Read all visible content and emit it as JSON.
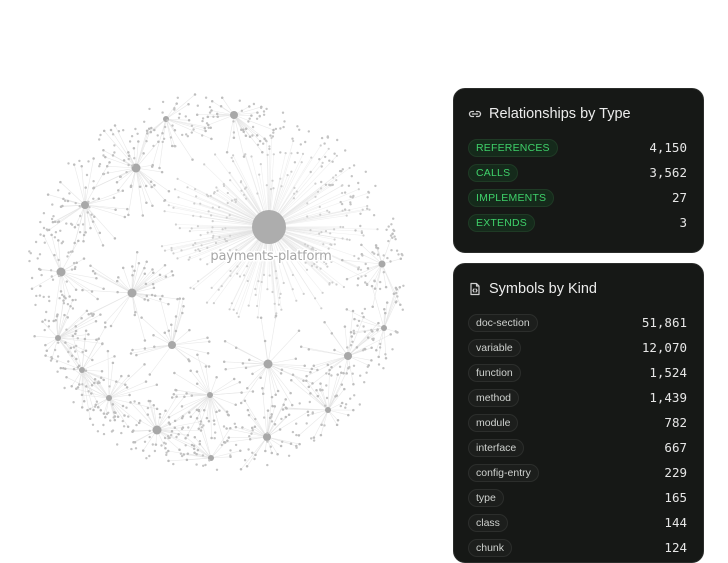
{
  "graph": {
    "center_label": "payments-platform"
  },
  "relationships_panel": {
    "title": "Relationships by Type",
    "icon": "link-icon",
    "items": [
      {
        "label": "REFERENCES",
        "count": "4,150"
      },
      {
        "label": "CALLS",
        "count": "3,562"
      },
      {
        "label": "IMPLEMENTS",
        "count": "27"
      },
      {
        "label": "EXTENDS",
        "count": "3"
      }
    ]
  },
  "symbols_panel": {
    "title": "Symbols by Kind",
    "icon": "file-code-icon",
    "items": [
      {
        "label": "doc-section",
        "count": "51,861"
      },
      {
        "label": "variable",
        "count": "12,070"
      },
      {
        "label": "function",
        "count": "1,524"
      },
      {
        "label": "method",
        "count": "1,439"
      },
      {
        "label": "module",
        "count": "782"
      },
      {
        "label": "interface",
        "count": "667"
      },
      {
        "label": "config-entry",
        "count": "229"
      },
      {
        "label": "type",
        "count": "165"
      },
      {
        "label": "class",
        "count": "144"
      },
      {
        "label": "chunk",
        "count": "124"
      }
    ]
  },
  "colors": {
    "panel_bg": "#161816",
    "badge_green": "#3fd16a",
    "graph_node": "#a8a8a8",
    "graph_edge": "#e2e2e2"
  }
}
